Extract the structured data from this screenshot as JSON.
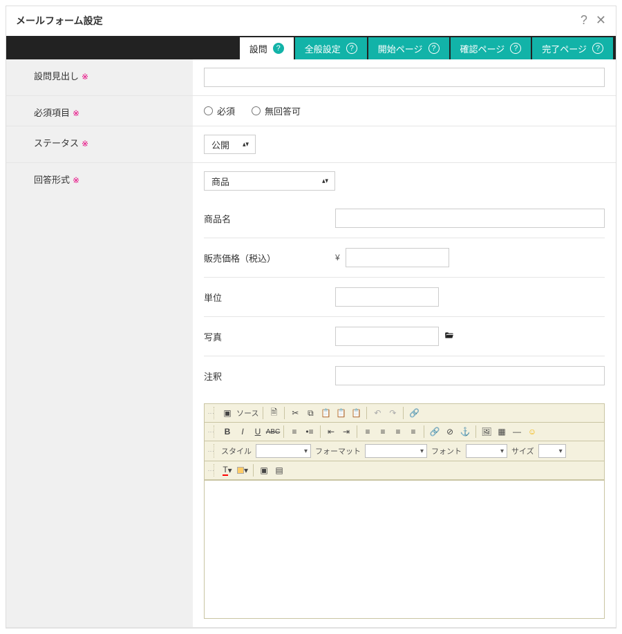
{
  "header": {
    "title": "メールフォーム設定",
    "help_icon": "?",
    "close_icon": "✕"
  },
  "tabs": [
    {
      "label": "設問",
      "active": true
    },
    {
      "label": "全般設定",
      "active": false
    },
    {
      "label": "開始ページ",
      "active": false
    },
    {
      "label": "確認ページ",
      "active": false
    },
    {
      "label": "完了ページ",
      "active": false
    }
  ],
  "required_mark": "※",
  "rows": {
    "heading": {
      "label": "設問見出し",
      "value": ""
    },
    "required": {
      "label": "必須項目",
      "options": [
        "必須",
        "無回答可"
      ]
    },
    "status": {
      "label": "ステータス",
      "value": "公開"
    },
    "answer_format": {
      "label": "回答形式",
      "value": "商品"
    }
  },
  "product": {
    "name": {
      "label": "商品名",
      "value": ""
    },
    "price": {
      "label": "販売価格（税込）",
      "currency": "¥",
      "value": ""
    },
    "unit": {
      "label": "単位",
      "value": ""
    },
    "photo": {
      "label": "写真",
      "value": ""
    },
    "note": {
      "label": "注釈",
      "value": ""
    }
  },
  "editor": {
    "source_label": "ソース",
    "style_label": "スタイル",
    "format_label": "フォーマット",
    "font_label": "フォント",
    "size_label": "サイズ"
  }
}
